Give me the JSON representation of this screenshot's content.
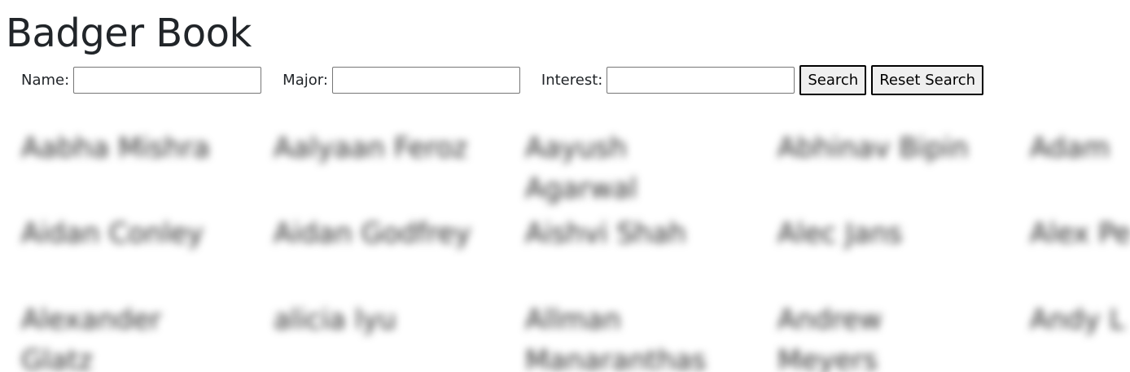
{
  "page": {
    "title": "Badger Book"
  },
  "search": {
    "name_label": "Name:",
    "name_value": "",
    "major_label": "Major:",
    "major_value": "",
    "interest_label": "Interest:",
    "interest_value": "",
    "search_button": "Search",
    "reset_button": "Reset Search"
  },
  "students": [
    "Aabha Mishra",
    "Aalyaan Feroz",
    "Aayush Agarwal",
    "Abhinav Bipin",
    "Adam",
    "Aidan Conley",
    "Aidan Godfrey",
    "Aishvi Shah",
    "Alec Jans",
    "Alex Pe",
    "Alexander Glatz",
    "alicia lyu",
    "Allman Manaranthas",
    "Andrew Meyers",
    "Andy L"
  ]
}
